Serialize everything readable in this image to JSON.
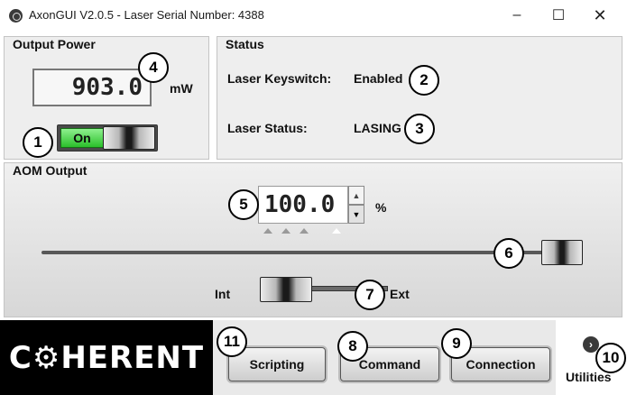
{
  "window": {
    "title": "AxonGUI V2.0.5 - Laser Serial Number: 4388",
    "minimize_glyph": "–",
    "maximize_glyph": "☐",
    "close_glyph": "✕"
  },
  "output_power": {
    "title": "Output Power",
    "value": "903.0",
    "unit": "mW",
    "toggle_label": "On"
  },
  "status": {
    "title": "Status",
    "keyswitch_label": "Laser Keyswitch:",
    "keyswitch_value": "Enabled",
    "laser_status_label": "Laser Status:",
    "laser_status_value": "LASING"
  },
  "aom_output": {
    "title": "AOM Output",
    "value": "100.0",
    "unit": "%",
    "spin_up_glyph": "▲",
    "spin_down_glyph": "▼",
    "slider_level_percent": 100,
    "switch_left_label": "Int",
    "switch_right_label": "Ext",
    "switch_position": "Int"
  },
  "bottom": {
    "logo_text": "C⚙HERENT",
    "buttons": [
      {
        "label": "Scripting"
      },
      {
        "label": "Command"
      },
      {
        "label": "Connection"
      }
    ],
    "utilities_label": "Utilities",
    "utilities_glyph": "›"
  },
  "callouts": [
    "1",
    "2",
    "3",
    "4",
    "5",
    "6",
    "7",
    "8",
    "9",
    "10",
    "11"
  ],
  "colors": {
    "on_green": "#2bc02b",
    "panel_bg": "#eeeeee",
    "logo_bg": "#000000"
  }
}
